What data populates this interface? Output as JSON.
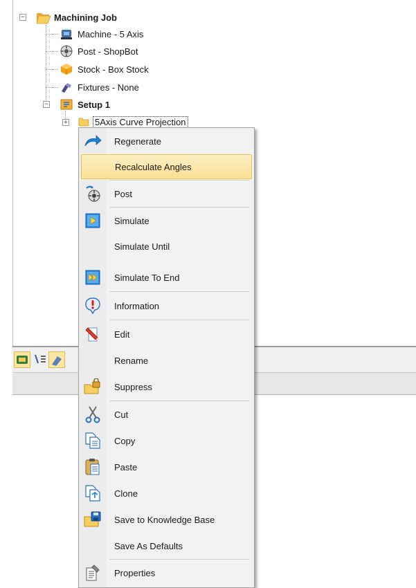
{
  "tree": {
    "root": {
      "label": "Machining Job",
      "expander": "−",
      "icon": "folder-open-icon"
    },
    "children": [
      {
        "label": "Machine - 5 Axis",
        "icon": "machine-icon"
      },
      {
        "label": "Post - ShopBot",
        "icon": "post-processor-icon"
      },
      {
        "label": "Stock - Box Stock",
        "icon": "stock-box-icon"
      },
      {
        "label": "Fixtures - None",
        "icon": "fixtures-icon"
      }
    ],
    "setup": {
      "label": "Setup 1",
      "expander": "−",
      "icon": "setup-icon"
    },
    "operation": {
      "label": "5Axis Curve Projection",
      "expander": "+",
      "icon": "folder-icon"
    }
  },
  "icon_bar": {
    "buttons": [
      "machining-job-icon",
      "tool-list-icon",
      "operations-view-icon"
    ]
  },
  "context_menu": {
    "items": [
      {
        "label": "Regenerate",
        "icon": "regenerate-icon"
      },
      {
        "label": "Recalculate Angles",
        "icon": "",
        "highlighted": true
      },
      {
        "label": "Post",
        "icon": "post-icon"
      },
      {
        "label": "Simulate",
        "icon": "simulate-icon"
      },
      {
        "label": "Simulate Until",
        "icon": ""
      },
      {
        "label": "Simulate To End",
        "icon": "simulate-to-end-icon"
      },
      {
        "label": "Information",
        "icon": "information-icon"
      },
      {
        "label": "Edit",
        "icon": "edit-icon"
      },
      {
        "label": "Rename",
        "icon": ""
      },
      {
        "label": "Suppress",
        "icon": "suppress-icon"
      },
      {
        "label": "Cut",
        "icon": "cut-icon"
      },
      {
        "label": "Copy",
        "icon": "copy-icon"
      },
      {
        "label": "Paste",
        "icon": "paste-icon"
      },
      {
        "label": "Clone",
        "icon": "clone-icon"
      },
      {
        "label": "Save to Knowledge Base",
        "icon": "save-knowledge-base-icon"
      },
      {
        "label": "Save As Defaults",
        "icon": ""
      },
      {
        "label": "Properties",
        "icon": "properties-icon"
      }
    ]
  },
  "colors": {
    "highlight": "#fbe096",
    "accent_blue": "#1f7fd6"
  }
}
